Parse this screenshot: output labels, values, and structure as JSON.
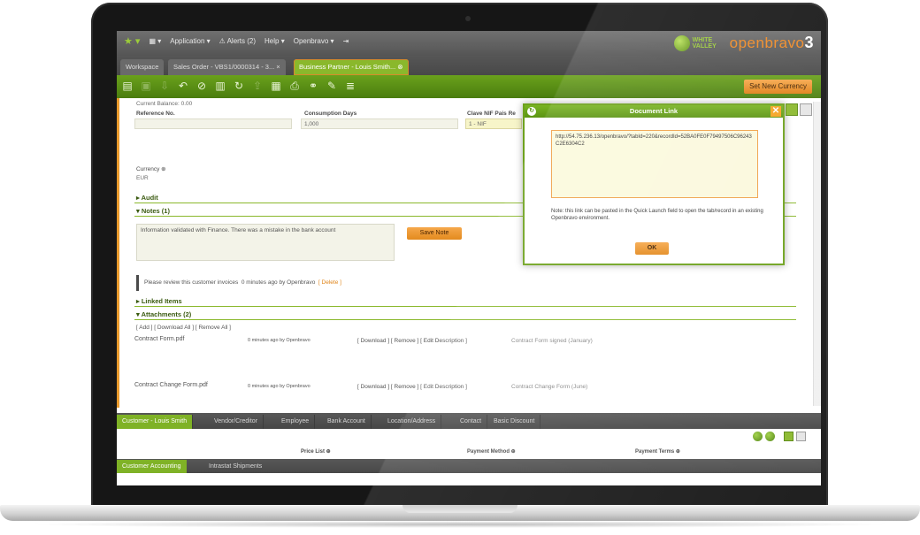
{
  "app": {
    "menu": [
      "★ ▾",
      "▦ ▾",
      "Application ▾",
      "⚠ Alerts (2)",
      "Help ▾",
      "Openbravo ▾",
      "⇥"
    ],
    "brand_left": "WHITE VALLEY",
    "brand_right": "openbravo",
    "brand_version": "3"
  },
  "workspace_tabs": [
    "Workspace",
    "Sales Order - VBS1/0000314 - 3... ×",
    "Business Partner - Louis Smith... ⊗"
  ],
  "toolbar": {
    "set_new_currency": "Set New Currency"
  },
  "form": {
    "current_balance": "Current Balance: 0.00",
    "reference_no_label": "Reference No.",
    "consumption_days_label": "Consumption Days",
    "consumption_days_value": "1,000",
    "clave_nif_label": "Clave NIF Pais Re",
    "clave_nif_value": "1 - NIF",
    "currency_label": "Currency ⊕",
    "currency_value": "EUR",
    "audit": "▸ Audit",
    "notes": "▾ Notes (1)",
    "note_text": "Information validated with Finance. There was a mistake in the bank account",
    "save_note": "Save Note",
    "review_text": "Please review this customer invoices",
    "review_meta": "0 minutes ago by Openbravo",
    "review_delete": "[ Delete ]",
    "linked_items": "▸ Linked Items",
    "attachments": "▾ Attachments (2)",
    "attach_actions": "[ Add ]  [ Download All ]  [ Remove All ]",
    "attachment_rows": [
      {
        "name": "Contract Form.pdf",
        "meta": "0 minutes ago by Openbravo",
        "actions": "[ Download ]  [ Remove ]  [ Edit Description ]",
        "desc": "Contract Form signed (January)"
      },
      {
        "name": "Contract Change Form.pdf",
        "meta": "0 minutes ago by Openbravo",
        "actions": "[ Download ]  [ Remove ]  [ Edit Description ]",
        "desc": "Contract Change Form (June)"
      }
    ]
  },
  "bottom_tabs": [
    "Customer - Louis Smith",
    "Vendor/Creditor",
    "Employee",
    "Bank Account",
    "Location/Address",
    "Contact",
    "Basic Discount"
  ],
  "bottom_fields": [
    "Price List ⊕",
    "Payment Method ⊕",
    "Payment Terms ⊕"
  ],
  "bottom_tabs2": [
    "Customer Accounting",
    "Intrastat Shipments"
  ],
  "modal": {
    "title": "Document Link",
    "url": "http://54.75.236.13/openbravo/?tabId=220&recordId=52BA0FE0F79497506C96243C2E6304C2",
    "note": "Note: this link can be pasted in the Quick Launch field to open the tab/record in an existing Openbravo environment.",
    "ok": "OK"
  },
  "colors": {
    "accent_green": "#6ea21d",
    "accent_orange": "#e38a1e"
  }
}
